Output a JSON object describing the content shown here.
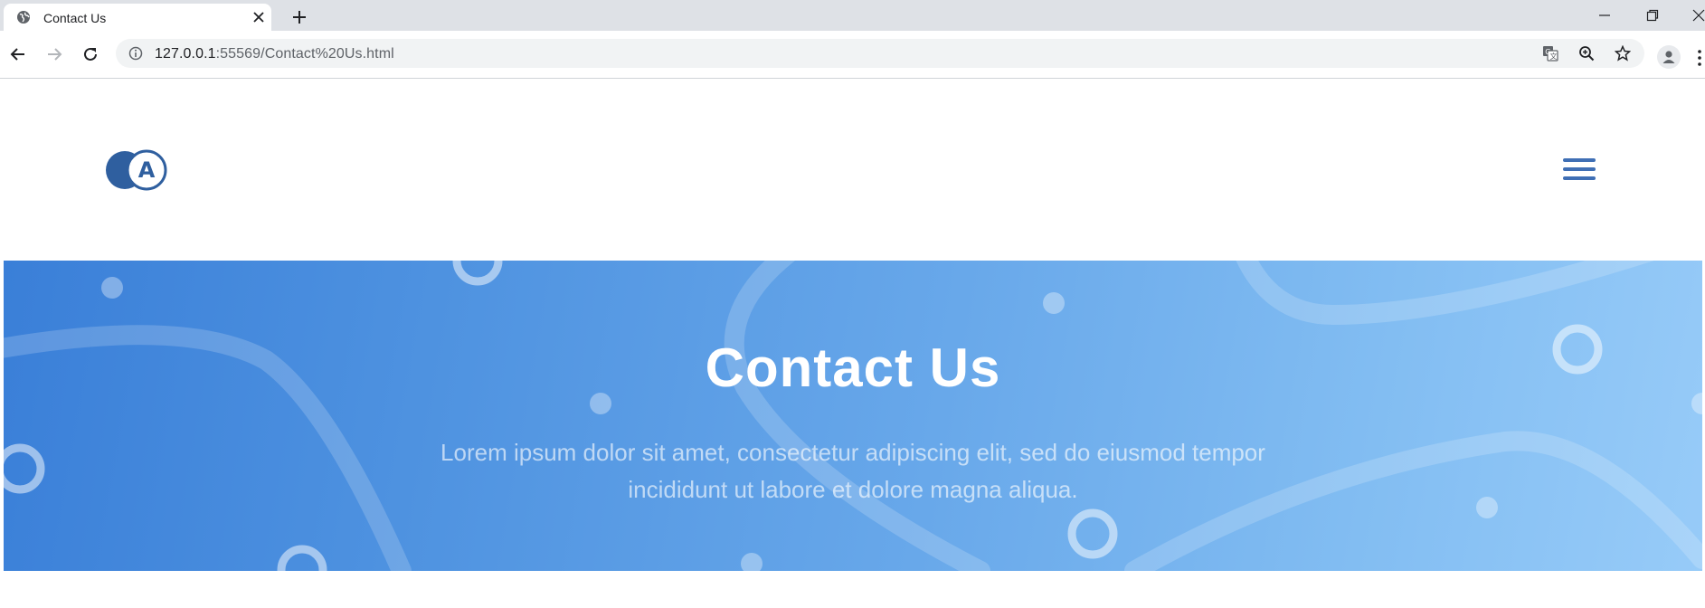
{
  "browser": {
    "tab_title": "Contact Us",
    "url_host": "127.0.0.1",
    "url_rest": ":55569/Contact%20Us.html",
    "icons": [
      "globe-icon",
      "close-icon",
      "plus-icon",
      "minimize-icon",
      "restore-icon",
      "back-icon",
      "forward-icon",
      "reload-icon",
      "info-icon",
      "translate-icon",
      "zoom-icon",
      "star-icon",
      "profile-icon",
      "menu-icon"
    ]
  },
  "header": {
    "logo_letter": "A",
    "menu_icon": "hamburger-icon"
  },
  "hero": {
    "title": "Contact Us",
    "text": "Lorem ipsum dolor sit amet, consectetur adipiscing elit, sed do eiusmod tempor incididunt ut labore et dolore magna aliqua."
  },
  "colors": {
    "brand": "#3f6fb5",
    "hero_start": "#3a7fd8",
    "hero_end": "#97cbf8"
  }
}
